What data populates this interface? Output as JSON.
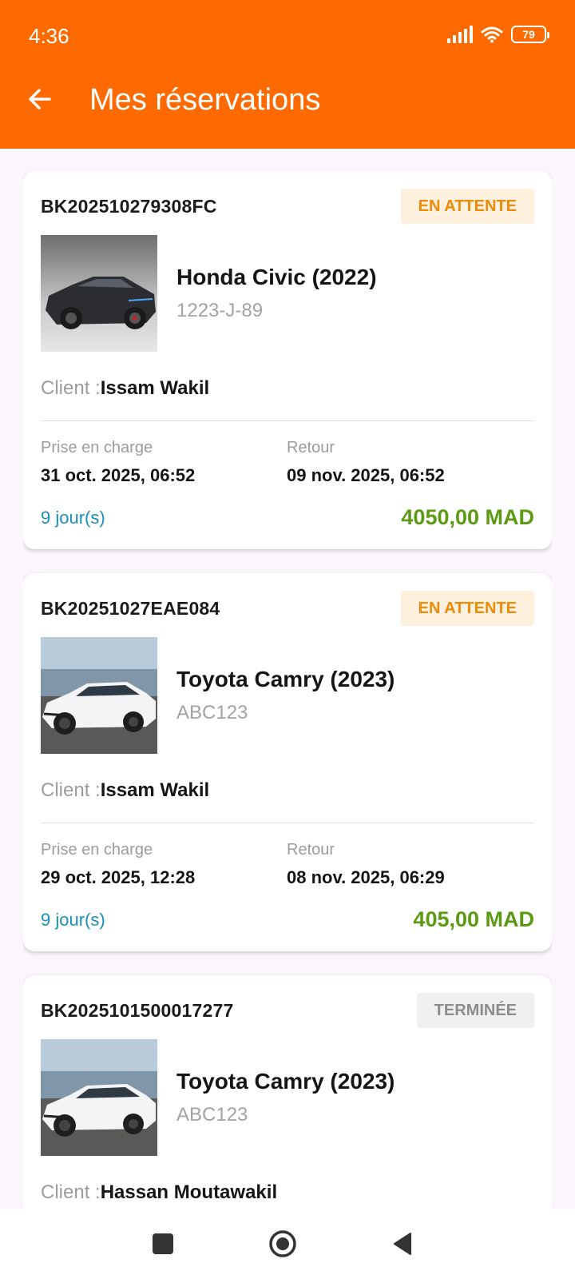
{
  "status_bar": {
    "time": "4:36",
    "battery": "79"
  },
  "header": {
    "title": "Mes réservations"
  },
  "reservations": [
    {
      "id": "BK202510279308FC",
      "status": "EN ATTENTE",
      "car_name": "Honda Civic (2022)",
      "plate": "1223-J-89",
      "client_label": "Client :",
      "client_name": "Issam Wakil",
      "pickup_label": "Prise en charge",
      "pickup_date": "31 oct. 2025, 06:52",
      "return_label": "Retour",
      "return_date": "09 nov. 2025, 06:52",
      "duration": "9 jour(s)",
      "price": "4050,00 MAD"
    },
    {
      "id": "BK20251027EAE084",
      "status": "EN ATTENTE",
      "car_name": "Toyota Camry (2023)",
      "plate": "ABC123",
      "client_label": "Client :",
      "client_name": "Issam Wakil",
      "pickup_label": "Prise en charge",
      "pickup_date": "29 oct. 2025, 12:28",
      "return_label": "Retour",
      "return_date": "08 nov. 2025, 06:29",
      "duration": "9 jour(s)",
      "price": "405,00 MAD"
    },
    {
      "id": "BK2025101500017277",
      "status": "TERMINÉE",
      "car_name": "Toyota Camry (2023)",
      "plate": "ABC123",
      "client_label": "Client :",
      "client_name": "Hassan Moutawakil"
    }
  ],
  "colors": {
    "app_bar": "#ff6a00",
    "pending_text": "#ec8a09",
    "pending_bg": "#fdf0dd",
    "done_text": "#8c8c8c",
    "price": "#5b9a12",
    "duration": "#1a8fb8"
  },
  "icons": {
    "back": "arrow-left-icon",
    "nav_recent": "square-icon",
    "nav_home": "circle-icon",
    "nav_back": "triangle-back-icon"
  }
}
